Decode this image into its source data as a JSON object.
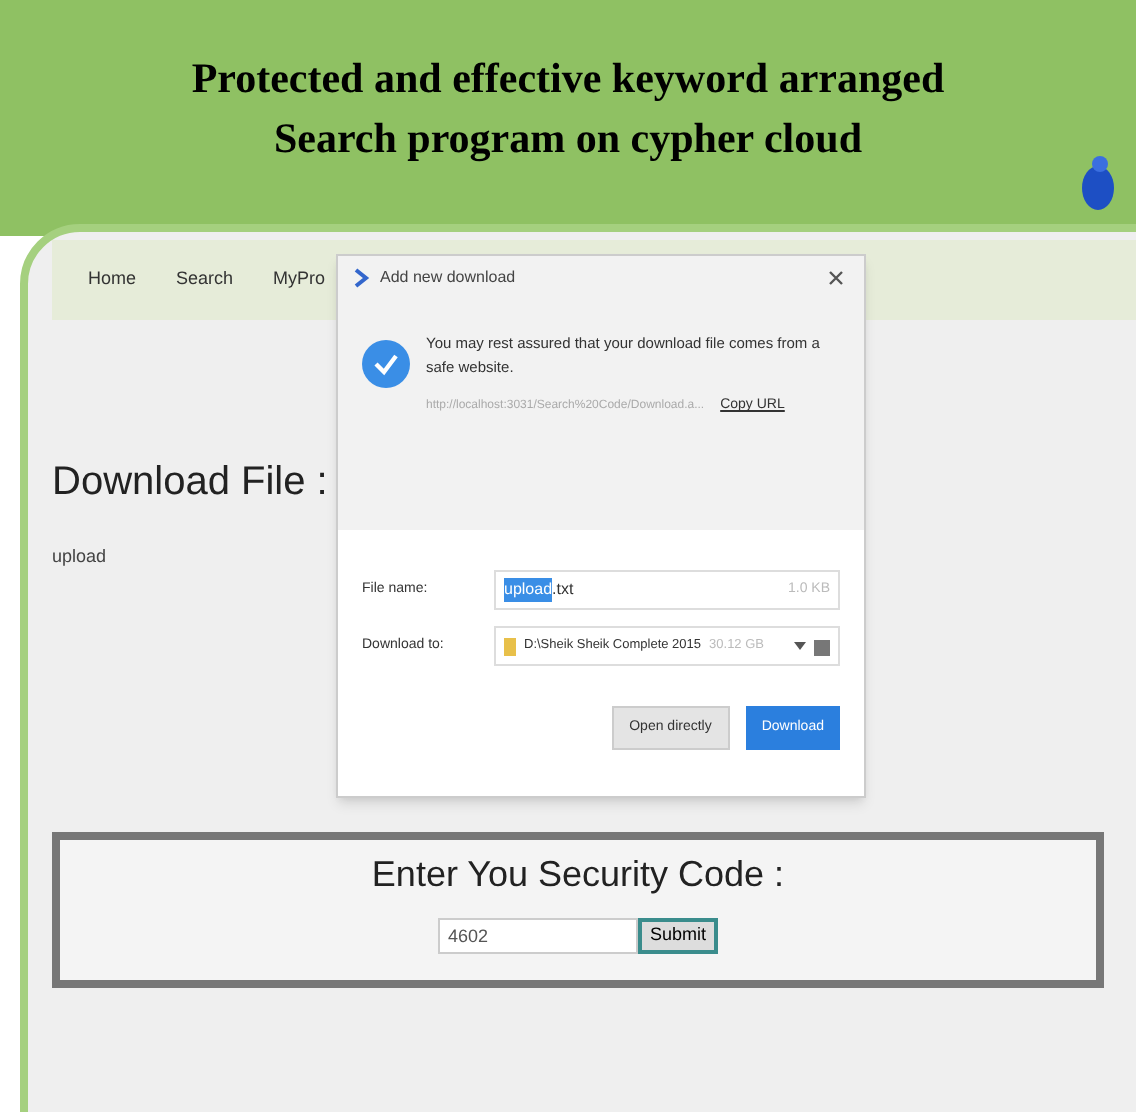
{
  "header": {
    "title_lines": [
      "Protected and effective keyword arranged",
      "Search program on cypher cloud"
    ]
  },
  "nav": {
    "items": [
      {
        "label": "Home"
      },
      {
        "label": "Search"
      },
      {
        "label": "MyPro"
      }
    ]
  },
  "content": {
    "heading": "Download File :",
    "file_link": "upload"
  },
  "dialog": {
    "title": "Add new download",
    "message": "You may rest assured that your download file comes from a safe website.",
    "url": "http://localhost:3031/Search%20Code/Download.a...",
    "copy_link": "Copy URL",
    "file_name_label": "File name:",
    "file_name_selected": "upload",
    "file_name_rest": ".txt",
    "file_size": "1.0 KB",
    "download_to_label": "Download to:",
    "folder": "D:\\Sheik Sheik Complete 2015",
    "free_space": "30.12 GB",
    "buttons": [
      {
        "label": "Open directly",
        "kind": "secondary"
      },
      {
        "label": "Download",
        "kind": "primary"
      }
    ]
  },
  "security": {
    "label": "Enter You Security Code :",
    "value": "4602",
    "submit": "Submit"
  }
}
